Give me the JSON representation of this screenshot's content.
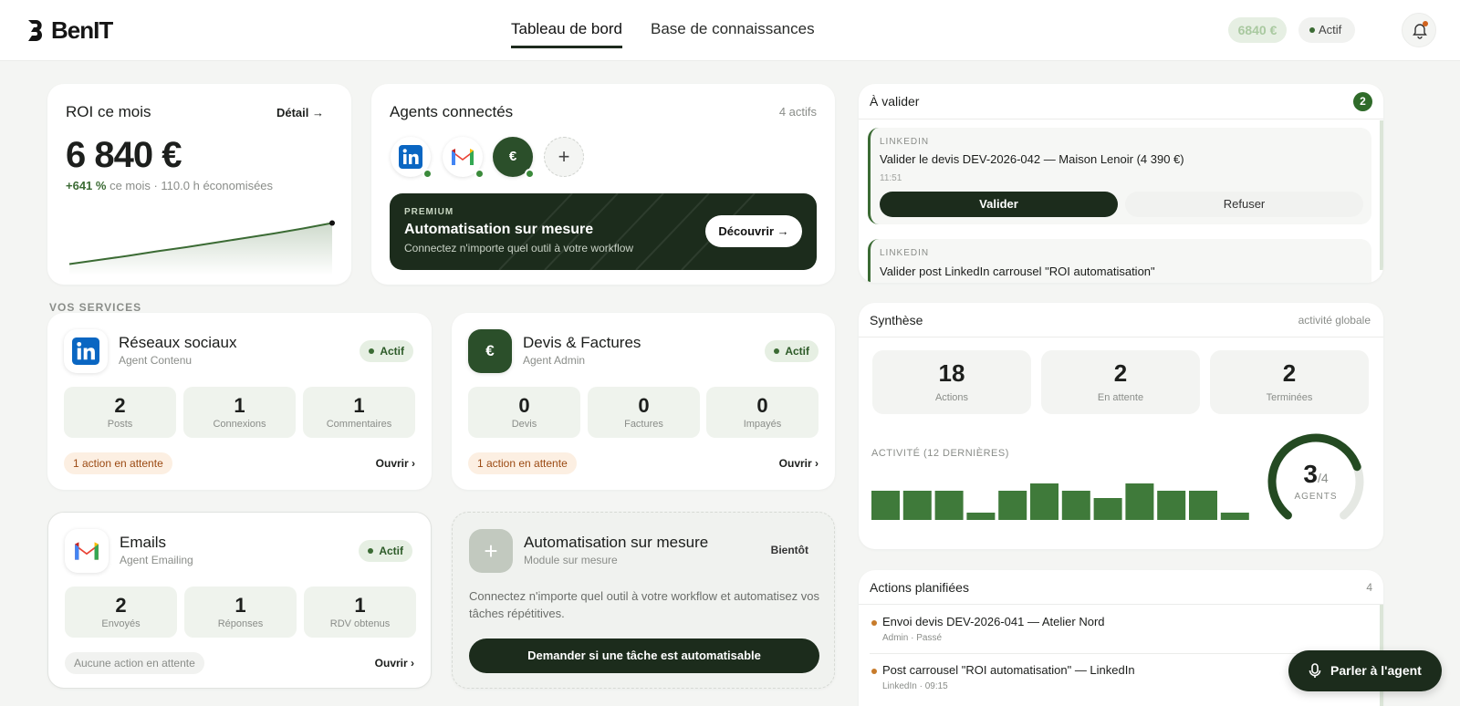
{
  "brand": {
    "name": "BenIT"
  },
  "nav": {
    "tabs": [
      {
        "label": "Tableau de bord"
      },
      {
        "label": "Base de connaissances"
      }
    ]
  },
  "header": {
    "roi_badge": "6840 €",
    "status": "Actif"
  },
  "roi": {
    "title": "ROI ce mois",
    "detail_link": "Détail →",
    "value": "6 840 €",
    "growth": "+641 %",
    "sub": "ce mois · 110.0 h économisées"
  },
  "agents": {
    "title": "Agents connectés",
    "count": "4 actifs",
    "items": [
      {
        "icon": "linkedin-icon"
      },
      {
        "icon": "gmail-icon"
      },
      {
        "icon": "euro-icon",
        "label": "€"
      }
    ],
    "add_label": "+"
  },
  "premium": {
    "kicker": "PREMIUM",
    "title": "Automatisation sur mesure",
    "sub": "Connectez n'importe quel outil à votre workflow",
    "button": "Découvrir"
  },
  "services": {
    "label": "VOS SERVICES",
    "social": {
      "name": "Réseaux sociaux",
      "sub": "Agent Contenu",
      "status": "Actif",
      "stats": [
        {
          "num": "2",
          "label": "Posts"
        },
        {
          "num": "1",
          "label": "Connexions"
        },
        {
          "num": "1",
          "label": "Commentaires"
        }
      ],
      "pending": "1 action en attente",
      "open": "Ouvrir ›"
    },
    "devis": {
      "name": "Devis & Factures",
      "sub": "Agent Admin",
      "status": "Actif",
      "icon_label": "€",
      "stats": [
        {
          "num": "0",
          "label": "Devis"
        },
        {
          "num": "0",
          "label": "Factures"
        },
        {
          "num": "0",
          "label": "Impayés"
        }
      ],
      "pending": "1 action en attente",
      "open": "Ouvrir ›"
    },
    "emails": {
      "name": "Emails",
      "sub": "Agent Emailing",
      "status": "Actif",
      "stats": [
        {
          "num": "2",
          "label": "Envoyés"
        },
        {
          "num": "1",
          "label": "Réponses"
        },
        {
          "num": "1",
          "label": "RDV obtenus"
        }
      ],
      "pending": "Aucune action en attente",
      "open": "Ouvrir ›"
    },
    "custom": {
      "name": "Automatisation sur mesure",
      "sub": "Module sur mesure",
      "badge": "Bientôt",
      "icon_label": "+",
      "desc": "Connectez n'importe quel outil à votre workflow et automatisez vos tâches répétitives.",
      "button": "Demander si une tâche est automatisable"
    }
  },
  "validate": {
    "title": "À valider",
    "count": "2",
    "items": [
      {
        "kicker": "LINKEDIN",
        "text": "Valider le devis DEV-2026-042 — Maison Lenoir (4 390 €)",
        "time": "11:51",
        "accept": "Valider",
        "reject": "Refuser"
      },
      {
        "kicker": "LINKEDIN",
        "text": "Valider post LinkedIn carrousel \"ROI automatisation\""
      }
    ]
  },
  "synthese": {
    "title": "Synthèse",
    "meta": "activité globale",
    "stats": [
      {
        "num": "18",
        "label": "Actions"
      },
      {
        "num": "2",
        "label": "En attente"
      },
      {
        "num": "2",
        "label": "Terminées"
      }
    ],
    "activity_label": "ACTIVITÉ (12 DERNIÈRES)",
    "gauge": {
      "value": "3",
      "total": "/4",
      "label": "AGENTS",
      "fraction": 0.75
    }
  },
  "planned": {
    "title": "Actions planifiées",
    "count": "4",
    "items": [
      {
        "title": "Envoi devis DEV-2026-041 — Atelier Nord",
        "sub": "Admin · Passé"
      },
      {
        "title": "Post carrousel \"ROI automatisation\" — LinkedIn",
        "sub": "LinkedIn · 09:15"
      }
    ]
  },
  "talk_button": "Parler à l'agent",
  "colors": {
    "accent": "#1c2c1c",
    "green": "#3b6b34",
    "bar": "#3f7a3a"
  },
  "chart_data": [
    {
      "type": "line",
      "x": [
        1,
        2,
        3,
        4,
        5,
        6,
        7,
        8,
        9,
        10
      ],
      "values": [
        0.05,
        0.14,
        0.23,
        0.33,
        0.42,
        0.52,
        0.62,
        0.72,
        0.83,
        0.95
      ]
    },
    {
      "type": "bar",
      "values": [
        4,
        4,
        4,
        1,
        4,
        5,
        4,
        3,
        5,
        4,
        4,
        1
      ],
      "ylim": [
        0,
        5
      ]
    }
  ]
}
